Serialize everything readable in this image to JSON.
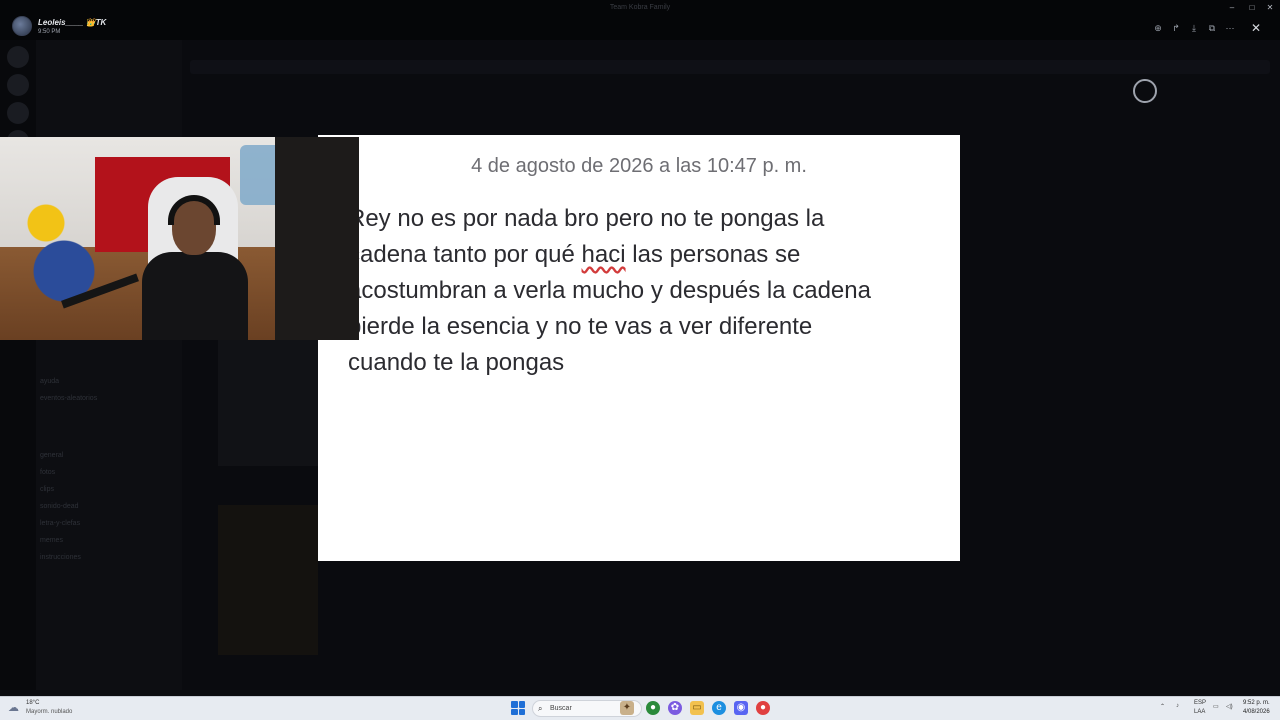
{
  "viewer": {
    "username": "Leoleis____",
    "badge": "👑TK",
    "time": "9:50 PM",
    "window_title": "Team Kobra Family",
    "actions": [
      "zoom-in-icon",
      "share-icon",
      "download-icon",
      "open-external-icon",
      "more-icon"
    ]
  },
  "viewed_image": {
    "date": "4 de agosto de 2026 a las 10:47 p. m.",
    "message_line_1": "Rey no es por nada bro pero no te pongas la",
    "message_line_2_a": "cadena tanto por qué ",
    "message_line_2_misspelled": "haci",
    "message_line_2_b": " las personas se",
    "message_line_3": "acostumbran a verla mucho y después la cadena",
    "message_line_4": "pierde la esencia y no te vas a ver diferente",
    "message_line_5": "cuando te la pongas"
  },
  "background_channels": [
    "general",
    "fotos",
    "clips",
    "sonido-dead",
    "letra-y-clefas",
    "memes",
    "instrucciones",
    "ayuda",
    "eventos-aleatorios"
  ],
  "taskbar": {
    "weather_temp": "18°C",
    "weather_desc": "Mayorm. nublado",
    "search_label": "Buscar",
    "language_top": "ESP",
    "language_bottom": "LAA",
    "clock_time": "9:52 p. m.",
    "clock_date": "4/08/2026"
  }
}
